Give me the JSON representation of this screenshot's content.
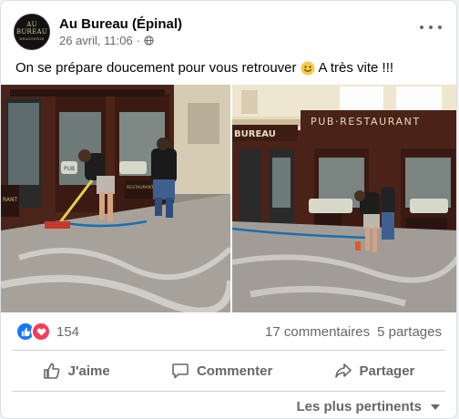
{
  "post": {
    "page_name": "Au Bureau (Épinal)",
    "date": "26 avril, 11:06",
    "separator": "·",
    "text_before": "On se prépare doucement pour vous retrouver",
    "text_after": "A très vite !!!",
    "avatar_logo": "AU BUREAU",
    "avatar_logo_sub": "BRASSERIE"
  },
  "photos": {
    "right_sign_main": "PUB·RESTAURANT",
    "right_sign_bureau": "BUREAU",
    "left_sign_pub": "PUB",
    "left_sign_restaurant": "RESTAURANT",
    "left_sign_rant": "RANT"
  },
  "engagement": {
    "reaction_count": "154",
    "comments": "17 commentaires",
    "shares": "5 partages"
  },
  "actions": {
    "like": "J'aime",
    "comment": "Commenter",
    "share": "Partager"
  },
  "sort": {
    "label": "Les plus pertinents"
  },
  "colors": {
    "like_blue": "#1877f2",
    "love_red": "#f33e58",
    "secondary_text": "#65676b"
  }
}
